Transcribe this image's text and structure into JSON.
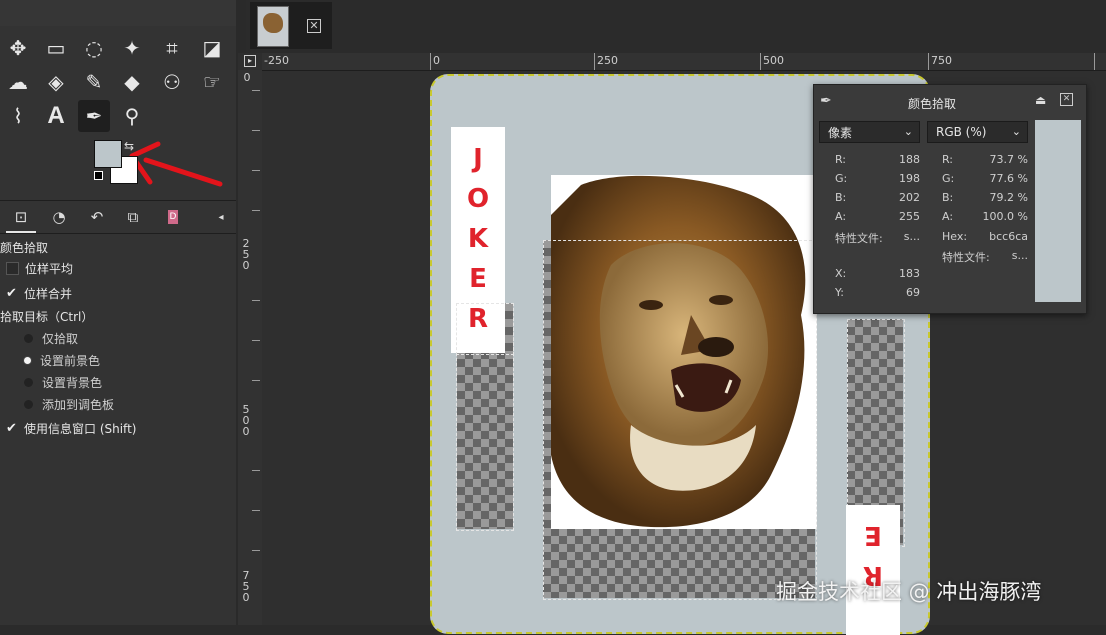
{
  "image_tabs": [
    {
      "name": "image-thumbnail"
    }
  ],
  "toolbox": {
    "tools": [
      {
        "name": "move-tool",
        "glyph": "✥"
      },
      {
        "name": "rect-select-tool",
        "glyph": "▭"
      },
      {
        "name": "lasso-tool",
        "glyph": "ᘎ"
      },
      {
        "name": "fuzzy-select-tool",
        "glyph": "⚝"
      },
      {
        "name": "crop-tool",
        "glyph": "⌗"
      },
      {
        "name": "transform-tool",
        "glyph": "⛶"
      },
      {
        "name": "warp-tool",
        "glyph": "☁"
      },
      {
        "name": "bucket-fill-tool",
        "glyph": "◈"
      },
      {
        "name": "paintbrush-tool",
        "glyph": "✎"
      },
      {
        "name": "eraser-tool",
        "glyph": "◆"
      },
      {
        "name": "clone-tool",
        "glyph": "⚇"
      },
      {
        "name": "smudge-tool",
        "glyph": "☞"
      },
      {
        "name": "paths-tool",
        "glyph": "⌇"
      },
      {
        "name": "text-tool",
        "glyph": "A"
      },
      {
        "name": "color-picker-tool",
        "glyph": "✒"
      },
      {
        "name": "zoom-tool",
        "glyph": "⚲"
      }
    ],
    "fg_color": "#bcc6ca",
    "bg_color": "#ffffff"
  },
  "tool_options": {
    "title": "颜色拾取",
    "sample_average": "位样平均",
    "sample_merged": "位样合并",
    "pick_target_label": "拾取目标（Ctrl）",
    "targets": [
      "仅拾取",
      "设置前景色",
      "设置背景色",
      "添加到调色板"
    ],
    "selected_target": "设置前景色",
    "use_info_window": "使用信息窗口 (Shift)"
  },
  "rulers": {
    "h_labels": [
      "-250",
      "0",
      "250",
      "500",
      "750"
    ],
    "v_labels": [
      "0",
      "250",
      "500",
      "750"
    ]
  },
  "canvas": {
    "joker_text": [
      "J",
      "O",
      "K",
      "E",
      "R"
    ],
    "card_color": "#bcc6ca"
  },
  "pointer_panel": {
    "title": "颜色拾取",
    "left_mode": "像素",
    "right_mode": "RGB (%)",
    "left_rows": [
      {
        "label": "R:",
        "value": "188"
      },
      {
        "label": "G:",
        "value": "198"
      },
      {
        "label": "B:",
        "value": "202"
      },
      {
        "label": "A:",
        "value": "255"
      },
      {
        "label": "特性文件:",
        "value": "s..."
      },
      {
        "label": "X:",
        "value": "183"
      },
      {
        "label": "Y:",
        "value": "69"
      }
    ],
    "right_rows": [
      {
        "label": "R:",
        "value": "73.7 %"
      },
      {
        "label": "G:",
        "value": "77.6 %"
      },
      {
        "label": "B:",
        "value": "79.2 %"
      },
      {
        "label": "A:",
        "value": "100.0 %"
      },
      {
        "label": "Hex:",
        "value": "bcc6ca"
      },
      {
        "label": "特性文件:",
        "value": "s..."
      }
    ],
    "swatch_color": "#bcc6ca"
  },
  "watermark": "掘金技术社区 @ 冲出海豚湾"
}
